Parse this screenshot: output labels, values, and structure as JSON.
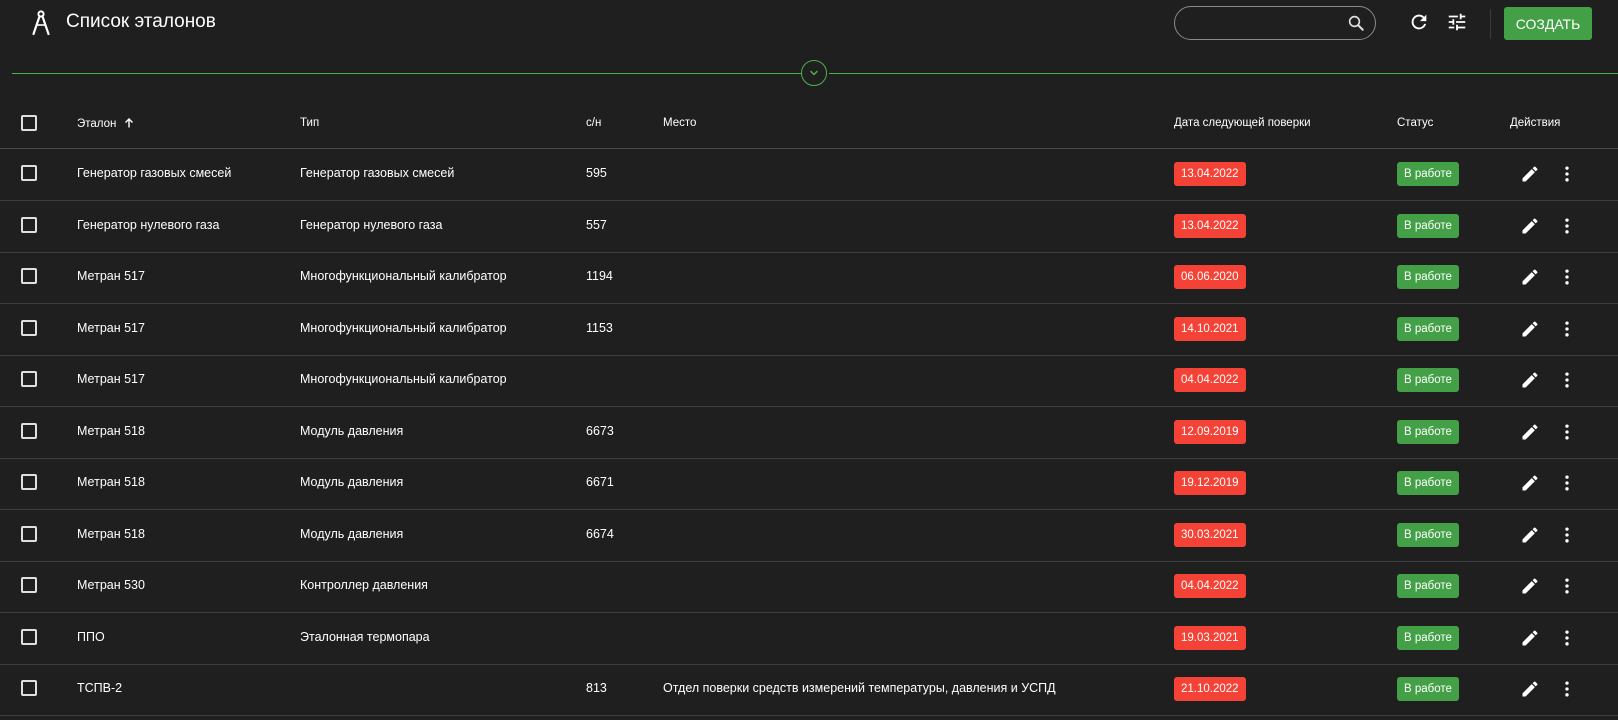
{
  "header": {
    "title": "Список эталонов",
    "search_value": "",
    "create_label": "Создать",
    "icons": [
      "compass-logo-icon",
      "search-icon",
      "refresh-icon",
      "tune-icon",
      "chevron-down-icon",
      "arrow-up-icon",
      "pencil-icon",
      "more-vert-icon"
    ]
  },
  "table": {
    "columns": {
      "standard": "Эталон",
      "type": "Тип",
      "serial": "с/н",
      "place": "Место",
      "next_check": "Дата следующей поверки",
      "status": "Статус",
      "actions": "Действия"
    },
    "sort_column": "standard",
    "sort_direction": "ascending",
    "rows": [
      {
        "standard": "Генератор газовых смесей",
        "type": "Генератор газовых смесей",
        "serial": "595",
        "place": "",
        "next_check": "13.04.2022",
        "status": "В работе"
      },
      {
        "standard": "Генератор нулевого газа",
        "type": "Генератор нулевого газа",
        "serial": "557",
        "place": "",
        "next_check": "13.04.2022",
        "status": "В работе"
      },
      {
        "standard": "Метран 517",
        "type": "Многофункциональный калибратор",
        "serial": "1194",
        "place": "",
        "next_check": "06.06.2020",
        "status": "В работе"
      },
      {
        "standard": "Метран 517",
        "type": "Многофункциональный калибратор",
        "serial": "1153",
        "place": "",
        "next_check": "14.10.2021",
        "status": "В работе"
      },
      {
        "standard": "Метран 517",
        "type": "Многофункциональный калибратор",
        "serial": "",
        "place": "",
        "next_check": "04.04.2022",
        "status": "В работе"
      },
      {
        "standard": "Метран 518",
        "type": "Модуль давления",
        "serial": "6673",
        "place": "",
        "next_check": "12.09.2019",
        "status": "В работе"
      },
      {
        "standard": "Метран 518",
        "type": "Модуль давления",
        "serial": "6671",
        "place": "",
        "next_check": "19.12.2019",
        "status": "В работе"
      },
      {
        "standard": "Метран 518",
        "type": "Модуль давления",
        "serial": "6674",
        "place": "",
        "next_check": "30.03.2021",
        "status": "В работе"
      },
      {
        "standard": "Метран 530",
        "type": "Контроллер давления",
        "serial": "",
        "place": "",
        "next_check": "04.04.2022",
        "status": "В работе"
      },
      {
        "standard": "ППО",
        "type": "Эталонная термопара",
        "serial": "",
        "place": "",
        "next_check": "19.03.2021",
        "status": "В работе"
      },
      {
        "standard": "ТСПВ-2",
        "type": "",
        "serial": "813",
        "place": "Отдел поверки средств измерений температуры, давления и УСПД",
        "next_check": "21.10.2022",
        "status": "В работе"
      }
    ]
  },
  "colors": {
    "background": "#1f1f1f",
    "accent_green": "#43a047",
    "divider_green": "#4caf50",
    "overdue_red": "#f44336"
  }
}
